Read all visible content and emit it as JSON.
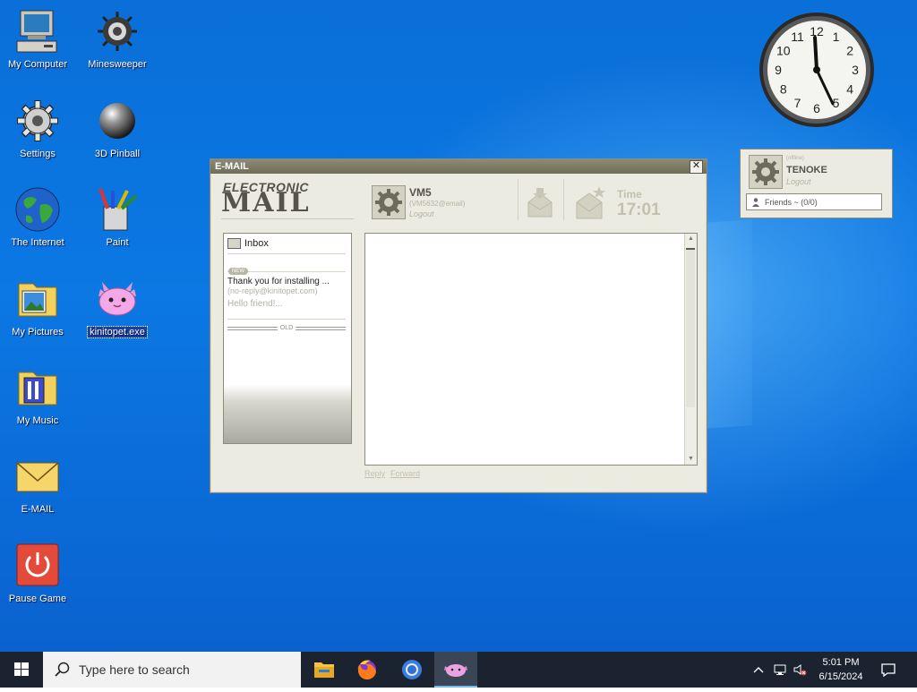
{
  "desktop_icons": [
    {
      "label": "My Computer"
    },
    {
      "label": "Minesweeper"
    },
    {
      "label": "Settings"
    },
    {
      "label": "3D Pinball"
    },
    {
      "label": "The Internet"
    },
    {
      "label": "Paint"
    },
    {
      "label": "My Pictures"
    },
    {
      "label": "kinitopet.exe"
    },
    {
      "label": "My Music"
    },
    {
      "label": "E-MAIL"
    },
    {
      "label": "Pause Game"
    }
  ],
  "clock": {
    "numbers": [
      "12",
      "1",
      "2",
      "3",
      "4",
      "5",
      "6",
      "7",
      "8",
      "9",
      "10",
      "11"
    ]
  },
  "email_window": {
    "title": "E-MAIL",
    "close_glyph": "✕",
    "logo_line1": "ELECTRONIC",
    "logo_line2": "MAIL",
    "user_name": "VM5",
    "user_address": "(VM5632@email)",
    "logout_label": "Logout",
    "time_label": "Time",
    "time_value": "17:01",
    "folder_inbox": "Inbox",
    "new_badge": "NEW",
    "message": {
      "subject": "Thank you for installing ...",
      "from": "(no-reply@kinitopet.com)",
      "preview": "Hello friend!..."
    },
    "old_divider": "OLD",
    "reply_label": "Reply",
    "forward_label": "Forward"
  },
  "friends_widget": {
    "status": "(offline)",
    "user_name": "TENOKE",
    "logout_label": "Logout",
    "friends_label": "Friends ~ (0/0)"
  },
  "taskbar": {
    "search_placeholder": "Type here to search",
    "time": "5:01 PM",
    "date": "6/15/2024"
  },
  "colors": {
    "accent": "#0b78e3",
    "window_bg": "#ecebe1",
    "taskbar": "#1b2330"
  }
}
